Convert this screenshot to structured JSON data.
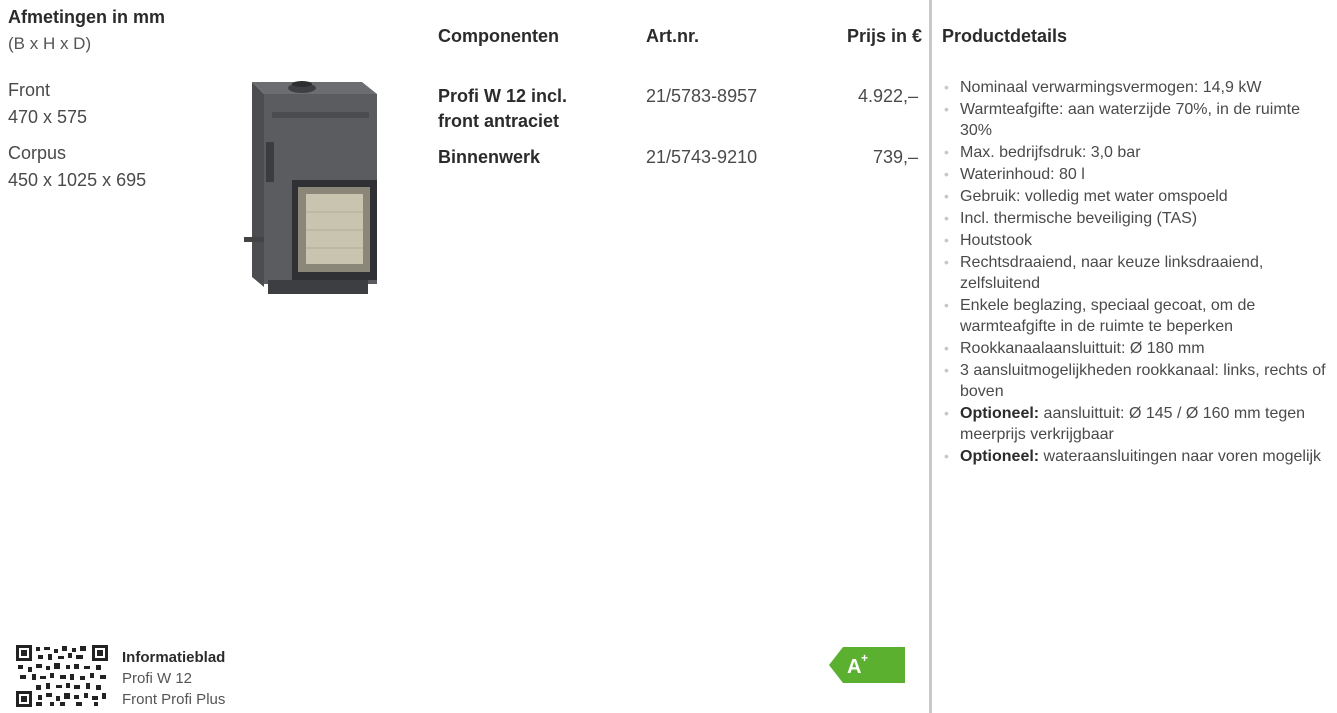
{
  "dimensions": {
    "header": "Afmetingen in mm",
    "subheader": "(B x H x D)",
    "front_label": "Front",
    "front_value": "470 x 575",
    "corpus_label": "Corpus",
    "corpus_value": "450 x 1025 x 695"
  },
  "table": {
    "headers": {
      "components": "Componenten",
      "art_nr": "Art.nr.",
      "price": "Prijs in €"
    },
    "rows": [
      {
        "component_line1": "Profi W 12 incl.",
        "component_line2": "front antraciet",
        "art_nr": "21/5783-8957",
        "price": "4.922,–"
      },
      {
        "component_line1": "Binnenwerk",
        "art_nr": "21/5743-9210",
        "price": "739,–"
      }
    ]
  },
  "details": {
    "header": "Productdetails",
    "items": [
      {
        "text": "Nominaal verwarmingsvermogen: 14,9 kW"
      },
      {
        "text": "Warmteafgifte: aan waterzijde 70%, in de ruimte 30%"
      },
      {
        "text": "Max. bedrijfsdruk: 3,0 bar"
      },
      {
        "text": "Waterinhoud: 80 l"
      },
      {
        "text": "Gebruik: volledig met water omspoeld"
      },
      {
        "text": "Incl. thermische beveiliging (TAS)"
      },
      {
        "text": "Houtstook"
      },
      {
        "text": "Rechtsdraaiend, naar keuze linksdraaiend, zelfsluitend"
      },
      {
        "text": "Enkele beglazing, speciaal gecoat, om de warmteafgifte in de ruimte te beperken"
      },
      {
        "text": "Rookkanaalaansluittuit: Ø 180 mm"
      },
      {
        "text": "3 aansluitmogelijkheden rookkanaal: links, rechts of boven"
      },
      {
        "bold": "Optioneel:",
        "text": " aansluittuit: Ø 145 / Ø 160 mm tegen meerprijs verkrijgbaar"
      },
      {
        "bold": "Optioneel:",
        "text": " wateraansluitingen naar voren mogelijk"
      }
    ]
  },
  "info": {
    "title": "Informatieblad",
    "line1": "Profi W 12",
    "line2": "Front Profi Plus"
  },
  "energy_label": {
    "class": "A",
    "sup": "+",
    "color": "#5cb030"
  },
  "icons": {
    "product": "fireplace-insert-image",
    "qr": "qr-code-icon",
    "bullet": "bullet-icon"
  }
}
